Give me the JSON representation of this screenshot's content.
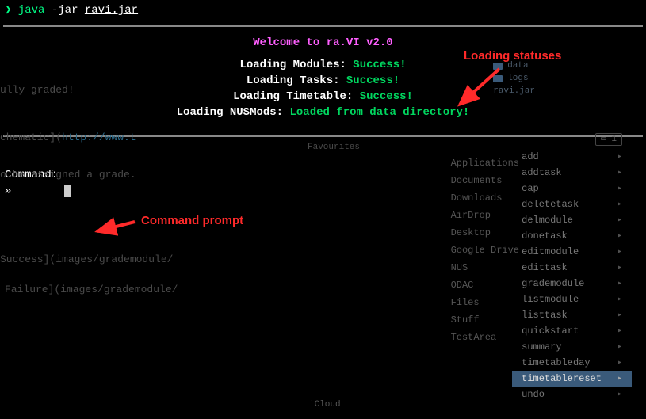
{
  "command_line": {
    "prompt": "❯",
    "cmd": "java",
    "flag": "-jar",
    "file": "ravi.jar"
  },
  "welcome": "Welcome to ra.VI v2.0",
  "loading": [
    {
      "label": "Loading Modules:",
      "status": "Success!"
    },
    {
      "label": "Loading Tasks:",
      "status": "Success!"
    },
    {
      "label": "Loading Timetable:",
      "status": "Success!"
    },
    {
      "label": "Loading NUSMods:",
      "status": "Loaded from data directory!"
    }
  ],
  "prompt": {
    "label": "Command:",
    "symbol": "»"
  },
  "annotations": {
    "loading_statuses": "Loading statuses",
    "command_prompt": "Command prompt"
  },
  "ghost_text": {
    "graded": "ully graded!",
    "schematic": "chematic](",
    "schematic_link": "http://www.t",
    "assigned": "o be assigned a grade.",
    "success_path": "Success](images/grademodule/",
    "failure_path": "Failure](images/grademodule/"
  },
  "ghost_top_files": [
    "data",
    "logs",
    "ravi.jar"
  ],
  "ghost_sidebar": [
    "Applications",
    "Documents",
    "Downloads",
    "AirDrop",
    "Desktop",
    "Google Drive",
    "NUS",
    "ODAC",
    "Files",
    "Stuff",
    "TestArea"
  ],
  "ghost_favourites": "Favourites",
  "ghost_icloud": "iCloud",
  "ghost_menu": {
    "highlighted": "timetablereset",
    "items": [
      "add",
      "addtask",
      "cap",
      "deletetask",
      "delmodule",
      "donetask",
      "editmodule",
      "edittask",
      "grademodule",
      "listmodule",
      "listtask",
      "quickstart",
      "summary",
      "timetableday",
      "timetablereset",
      "undo"
    ]
  },
  "ghost_tab": "1"
}
